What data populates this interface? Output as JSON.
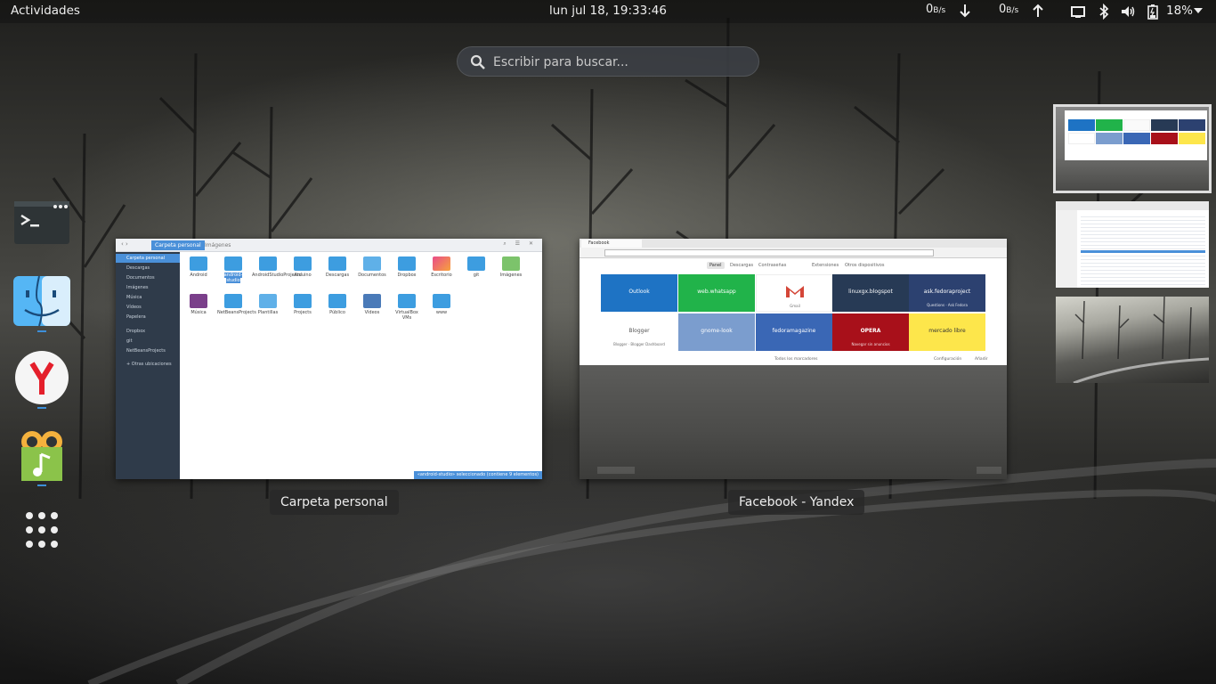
{
  "topbar": {
    "activities": "Actividades",
    "clock": "lun jul 18, 19:33:46",
    "net_down_value": "0",
    "net_down_unit": "B/s",
    "net_up_value": "0",
    "net_up_unit": "B/s",
    "battery_percent": "18%",
    "icons": [
      "arrow-down-icon",
      "arrow-up-icon",
      "screen-icon",
      "bluetooth-icon",
      "volume-icon",
      "battery-icon",
      "chevron-down-icon"
    ]
  },
  "search": {
    "placeholder": "Escribir para buscar..."
  },
  "dash": {
    "apps": [
      "terminal-icon",
      "files-icon",
      "yandex-browser-icon",
      "music-app-icon",
      "show-apps-icon"
    ]
  },
  "windows": [
    {
      "caption": "Carpeta personal"
    },
    {
      "caption": "Facebook - Yandex"
    }
  ],
  "file_manager": {
    "path_active": "Carpeta personal",
    "path_next": "Imágenes",
    "sidebar": [
      "Carpeta personal",
      "Descargas",
      "Documentos",
      "Imágenes",
      "Música",
      "Vídeos",
      "Papelera",
      "Dropbox",
      "git",
      "NetBeansProjects",
      "+ Otras ubicaciones"
    ],
    "files_row1": [
      "Android",
      "android-studio",
      "AndroidStudioProjects",
      "Arduino",
      "Descargas",
      "Documentos",
      "Dropbox",
      "Escritorio",
      "git",
      "Imágenes"
    ],
    "files_row2": [
      "Música",
      "NetBeansProjects",
      "Plantillas",
      "Projects",
      "Público",
      "Vídeos",
      "VirtualBox VMs",
      "www"
    ],
    "status": "«android-studio» seleccionado (contiene 9 elementos)"
  },
  "browser": {
    "tab_title": "Facebook",
    "nav": [
      "Panel",
      "Descargas",
      "Contraseñas",
      "Extensiones",
      "Otros dispositivos"
    ],
    "tiles": [
      {
        "name": "Outlook",
        "sub": "",
        "color": "#1e73c4"
      },
      {
        "name": "web.whatsapp",
        "sub": "",
        "color": "#21b34a"
      },
      {
        "name": "Gmail",
        "sub": "",
        "color": "#ffffff"
      },
      {
        "name": "linuxgx.blogspot",
        "sub": "",
        "color": "#273a55"
      },
      {
        "name": "ask.fedoraproject",
        "sub": "Questions · Ask Fedora",
        "color": "#2c4170"
      },
      {
        "name": "Blogger",
        "sub": "Blogger · Blogger Dashboard",
        "color": "#ffffff"
      },
      {
        "name": "gnome-look",
        "sub": "",
        "color": "#7b9dce"
      },
      {
        "name": "fedoramagazine",
        "sub": "",
        "color": "#3a67b5"
      },
      {
        "name": "OPERA",
        "sub": "Navegar sin anuncios",
        "color": "#a8101a"
      },
      {
        "name": "mercado libre",
        "sub": "",
        "color": "#fde64b"
      }
    ],
    "footer_left": "Todos los marcadores",
    "footer_right": "Configuración",
    "footer_add": "Añadir"
  }
}
